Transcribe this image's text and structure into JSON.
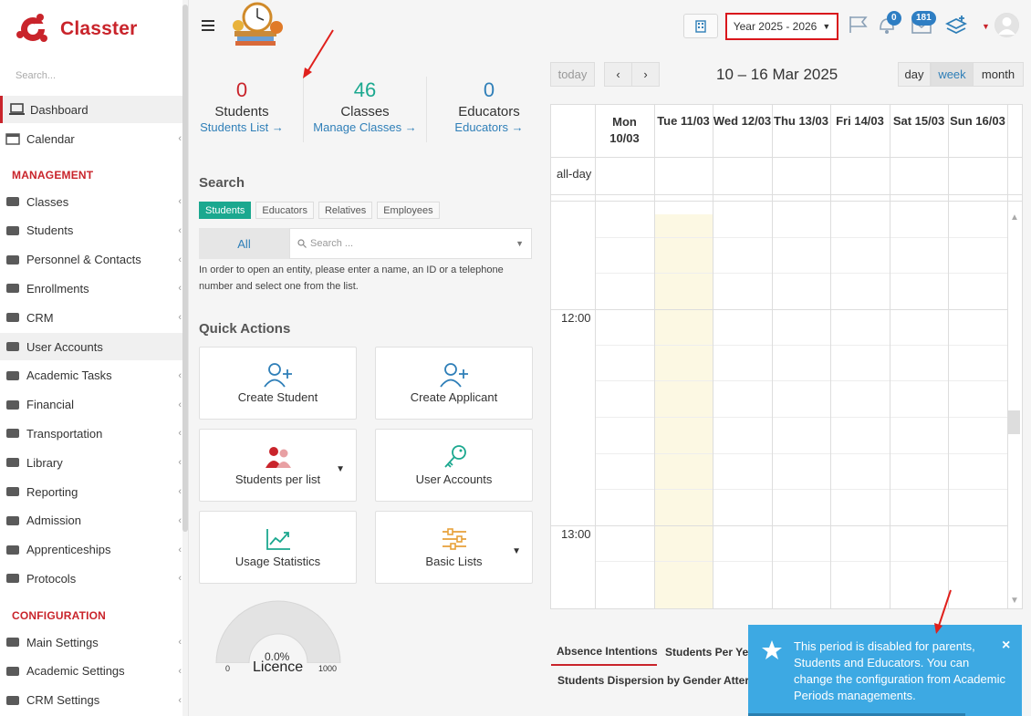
{
  "app": {
    "brand": "Classter"
  },
  "sidebar": {
    "search_placeholder": "Search...",
    "items": [
      {
        "label": "Dashboard",
        "icon": "laptop-icon"
      },
      {
        "label": "Calendar",
        "icon": "calendar-icon"
      }
    ],
    "management_title": "MANAGEMENT",
    "management": [
      {
        "label": "Classes",
        "icon": "classes-icon"
      },
      {
        "label": "Students",
        "icon": "students-icon"
      },
      {
        "label": "Personnel & Contacts",
        "icon": "person-icon"
      },
      {
        "label": "Enrollments",
        "icon": "exchange-icon"
      },
      {
        "label": "CRM",
        "icon": "crm-icon"
      },
      {
        "label": "User Accounts",
        "icon": "key-icon"
      },
      {
        "label": "Academic Tasks",
        "icon": "grid-icon"
      },
      {
        "label": "Financial",
        "icon": "coins-icon"
      },
      {
        "label": "Transportation",
        "icon": "bus-icon"
      },
      {
        "label": "Library",
        "icon": "books-icon"
      },
      {
        "label": "Reporting",
        "icon": "printer-icon"
      },
      {
        "label": "Admission",
        "icon": "bank-icon"
      },
      {
        "label": "Apprenticeships",
        "icon": "box-icon"
      },
      {
        "label": "Protocols",
        "icon": "protocol-icon"
      }
    ],
    "configuration_title": "CONFIGURATION",
    "configuration": [
      {
        "label": "Main Settings",
        "icon": "settings-icon"
      },
      {
        "label": "Academic Settings",
        "icon": "classes-icon"
      },
      {
        "label": "CRM Settings",
        "icon": "crm-icon"
      }
    ]
  },
  "header": {
    "academic_year": "Year 2025 - 2026",
    "notifications_count": "0",
    "messages_count": "181"
  },
  "stats": [
    {
      "value": "0",
      "label": "Students",
      "link": "Students List →",
      "color": "#c9242b"
    },
    {
      "value": "46",
      "label": "Classes",
      "link": "Manage Classes →",
      "color": "#1ba88f"
    },
    {
      "value": "0",
      "label": "Educators",
      "link": "Educators →",
      "color": "#2f7fb8"
    }
  ],
  "search": {
    "title": "Search",
    "tabs": [
      "Students",
      "Educators",
      "Relatives",
      "Employees"
    ],
    "scope": "All",
    "placeholder": "Search ...",
    "hint": "In order to open an entity, please enter a name, an ID or a telephone number and select one from the list."
  },
  "quick_actions": {
    "title": "Quick Actions",
    "items": [
      {
        "label": "Create Student",
        "icon": "add-user-icon"
      },
      {
        "label": "Create Applicant",
        "icon": "add-user-icon"
      },
      {
        "label": "Students per list",
        "icon": "users-group-icon"
      },
      {
        "label": "User Accounts",
        "icon": "key-icon"
      },
      {
        "label": "Usage Statistics",
        "icon": "trend-chart-icon"
      },
      {
        "label": "Basic Lists",
        "icon": "sliders-icon"
      }
    ]
  },
  "licence": {
    "label": "Licence",
    "percent": "0.0%",
    "min": "0",
    "max": "1000",
    "fraction": 0
  },
  "calendar": {
    "today": "today",
    "range": "10 – 16 Mar 2025",
    "views": [
      "day",
      "week",
      "month"
    ],
    "active_view": "week",
    "days": [
      "Mon\n10/03",
      "Tue 11/03",
      "Wed 12/03",
      "Thu 13/03",
      "Fri 14/03",
      "Sat 15/03",
      "Sun 16/03"
    ],
    "allday": "all-day",
    "times": [
      "12:00",
      "13:00"
    ]
  },
  "bottom_tabs": [
    "Absence Intentions",
    "Students Per Yea",
    "Students Dispersion by Gender",
    "Atter"
  ],
  "toast": {
    "message": "This period is disabled for parents, Students and Educators. You can change the configuration from Academic Periods managements."
  },
  "colors": {
    "brand": "#c9242b",
    "teal": "#1ba88f",
    "blue": "#2f7fb8",
    "toast": "#3da9e3"
  }
}
